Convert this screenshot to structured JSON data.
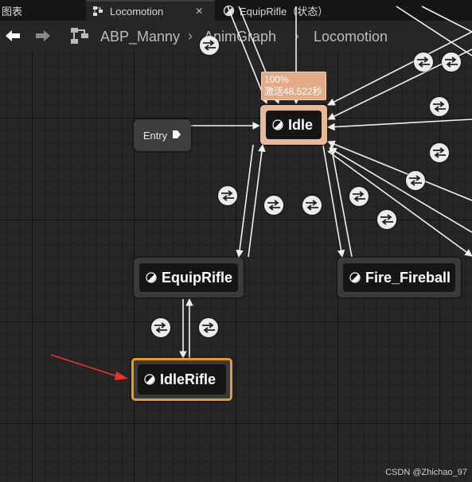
{
  "tabs": [
    {
      "label": "图表",
      "active": false
    },
    {
      "label": "Locomotion",
      "active": true,
      "icon": "state-machine-icon"
    },
    {
      "label": "EquipRifle（状态）",
      "active": false,
      "icon": "state-icon"
    }
  ],
  "nav": {
    "back_icon": "back-arrow-icon",
    "forward_icon": "forward-arrow-icon"
  },
  "breadcrumb": [
    "ABP_Manny",
    "AnimGraph",
    "Locomotion"
  ],
  "graph": {
    "entry_label": "Entry",
    "idle_status": {
      "weight": "100%",
      "active_time": "激活48.522秒"
    },
    "states": [
      {
        "id": "idle",
        "label": "Idle",
        "active": true
      },
      {
        "id": "equiprifle",
        "label": "EquipRifle"
      },
      {
        "id": "fire_fireball",
        "label": "Fire_Fireball"
      },
      {
        "id": "idlerifle",
        "label": "IdleRifle",
        "selected": true
      }
    ],
    "annotation_color": "#e8322c",
    "selection_color": "#e89e1c",
    "active_state_color": "#e8b89a"
  },
  "watermark": "CSDN @Zhichao_97"
}
